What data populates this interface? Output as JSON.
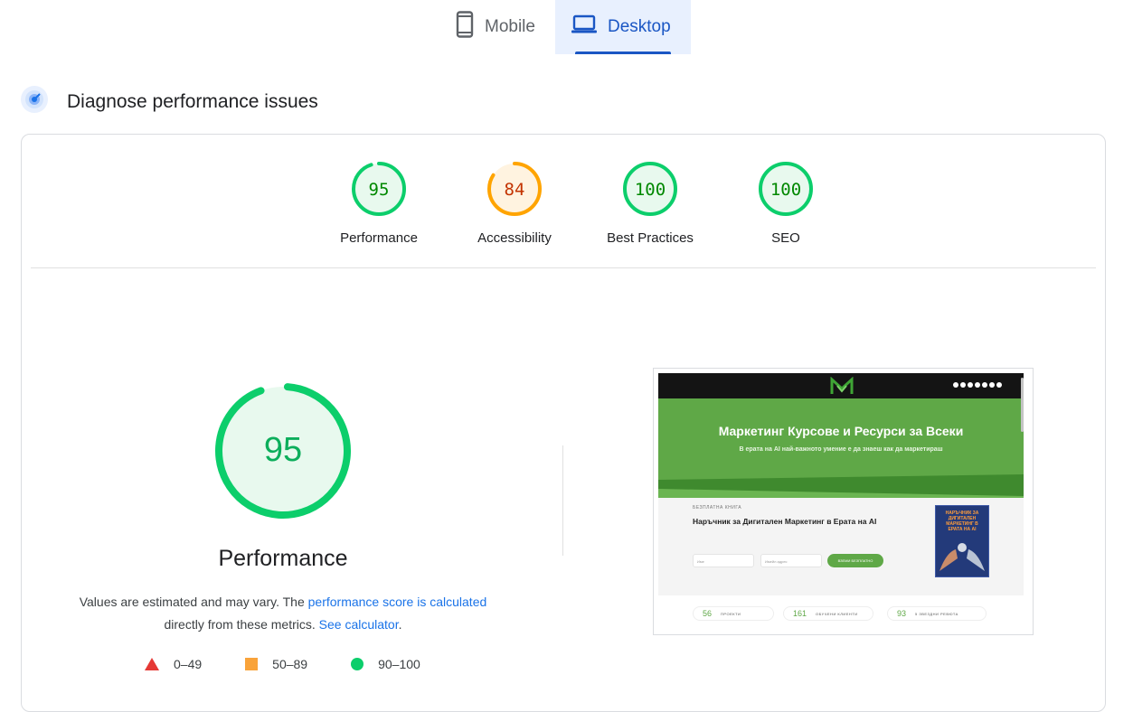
{
  "device_tabs": [
    {
      "label": "Mobile",
      "icon": "mobile-phone-icon",
      "active": false
    },
    {
      "label": "Desktop",
      "icon": "laptop-icon",
      "active": true
    }
  ],
  "section": {
    "title": "Diagnose performance issues",
    "icon": "diagnose-radar-icon"
  },
  "scores": [
    {
      "label": "Performance",
      "value": "95",
      "score": 95,
      "status": "pass"
    },
    {
      "label": "Accessibility",
      "value": "84",
      "score": 84,
      "status": "average"
    },
    {
      "label": "Best Practices",
      "value": "100",
      "score": 100,
      "status": "pass"
    },
    {
      "label": "SEO",
      "value": "100",
      "score": 100,
      "status": "pass"
    }
  ],
  "performance": {
    "score": "95",
    "title": "Performance",
    "note_prefix": "Values are estimated and may vary. The ",
    "note_link1": "performance score is calculated",
    "note_middle": "directly from these metrics.",
    "note_link2": "See calculator",
    "note_suffix": "."
  },
  "legend": [
    {
      "shape": "triangle",
      "range": "0–49",
      "color": "#e53935"
    },
    {
      "shape": "square",
      "range": "50–89",
      "color": "#f9a33a"
    },
    {
      "shape": "circle",
      "range": "90–100",
      "color": "#0cce6b"
    }
  ],
  "screenshot": {
    "hero_title": "Маркетинг Курсове и Ресурси за Всеки",
    "hero_subtitle": "В ерата на AI най-важното умение е да знаеш как да маркетираш",
    "eyebrow": "БЕЗПЛАТНА КНИГА",
    "heading": "Наръчник за Дигитален Маркетинг в Ерата на AI",
    "input1": "Име",
    "input2": "Имейл адрес",
    "cta": "ВЗЕМИ БЕЗПЛАТНО",
    "book_title": "НАРЪЧНИК ЗА ДИГИТАЛЕН МАРКЕТИНГ В ЕРАТА НА AI",
    "stats": [
      {
        "num": "56",
        "label": "ПРОЕКТИ"
      },
      {
        "num": "161",
        "label": "ОБУЧЕНИ КЛИЕНТИ"
      },
      {
        "num": "93",
        "label": "5 ЗВЕЗДНИ РЕВЮТА"
      }
    ]
  },
  "colors": {
    "pass": "#0cce6b",
    "pass_text": "#008800",
    "pass_fill": "#e8f9ee",
    "average": "#ffa400",
    "average_text": "#c33300",
    "average_fill": "#fff3e0",
    "fail": "#ff4e42",
    "accent": "#1a56c4"
  }
}
